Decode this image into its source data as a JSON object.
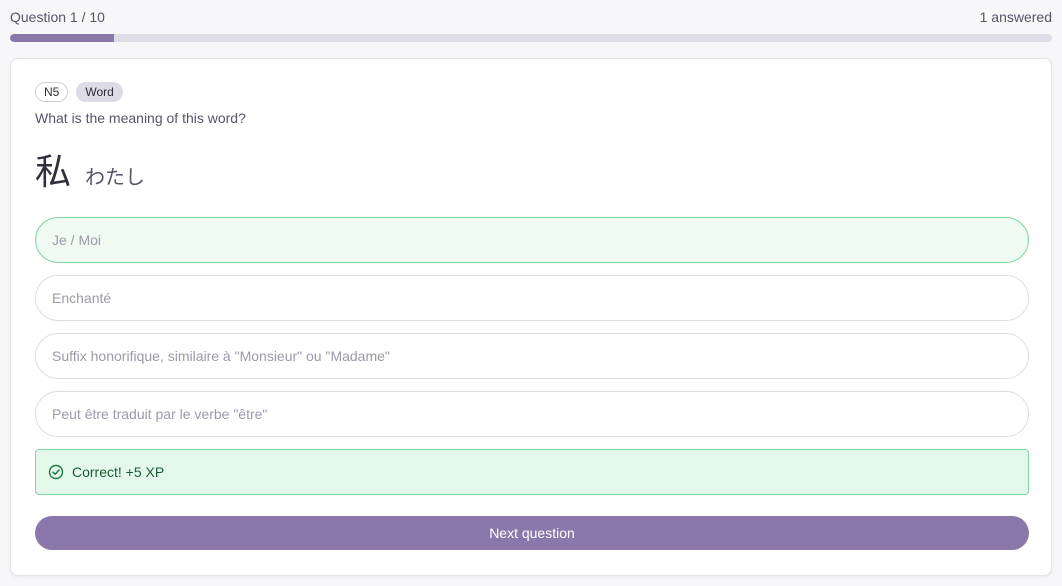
{
  "header": {
    "question_counter": "Question 1 / 10",
    "answered_count": "1 answered"
  },
  "progress": {
    "fraction": 0.1,
    "fill_color": "#8a78aa",
    "track_color": "#dddce5"
  },
  "card": {
    "badges": [
      "N5",
      "Word"
    ],
    "question": "What is the meaning of this word?",
    "word": "私",
    "reading": "わたし",
    "options": [
      {
        "label": "Je / Moi",
        "state": "correct"
      },
      {
        "label": "Enchanté",
        "state": "default"
      },
      {
        "label": "Suffix honorifique, similaire à \"Monsieur\" ou \"Madame\"",
        "state": "default"
      },
      {
        "label": "Peut être traduit par le verbe \"être\"",
        "state": "default"
      }
    ],
    "feedback": {
      "icon": "check-circle-icon",
      "text": "Correct! +5 XP"
    },
    "next_button": "Next question"
  },
  "colors": {
    "accent": "#8a78aa",
    "success_border": "#7fd5a0",
    "success_bg": "#e3f8eb",
    "success_text": "#1d5a33"
  }
}
